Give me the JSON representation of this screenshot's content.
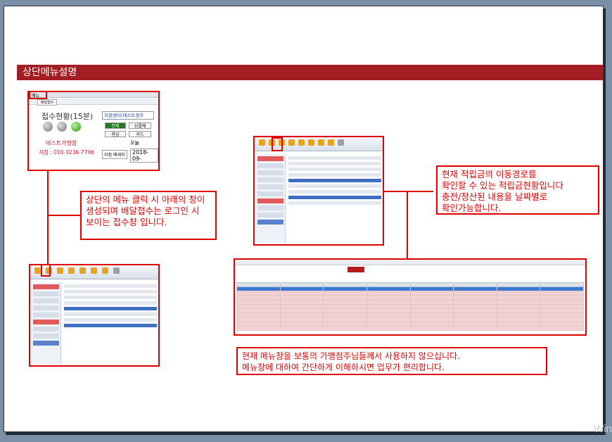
{
  "banner": {
    "title": "상단메뉴설명"
  },
  "thumb_login": {
    "menu_label": "메뉴",
    "tab_label": "배달접수",
    "status_title": "접수현황(15분)",
    "branch_select": "지원센터(테스트점주",
    "buttons": [
      "전체",
      "선결제",
      "현금",
      "카드"
    ],
    "shop_name": "테스트가맹점",
    "shop_phone": "지점 : 010-3236-7796",
    "today_label": "오늘",
    "message_button": "지점 메세지",
    "date_value": "2018-09-"
  },
  "callouts": {
    "left": [
      "상단의 메뉴 클릭 시 아래의 창이",
      "생성되며 배달접수는 로그인 시",
      "보이는 접수창 입니다."
    ],
    "right": [
      "현재 적립금의 이동경로를",
      "확인할 수 있는 적립금현황입니다",
      "충전/정산된 내용을 날짜별로",
      "확인가능합니다."
    ],
    "bottom": [
      "현재 메뉴창을 보통의 가맹점주님들께서 사용하지 않으십니다.",
      "메뉴창에 대하여 간단하게 이해하시면 업무가 편리합니다."
    ]
  },
  "watermark": "Win",
  "colors": {
    "banner": "#a31e22",
    "highlight": "#e00000"
  }
}
